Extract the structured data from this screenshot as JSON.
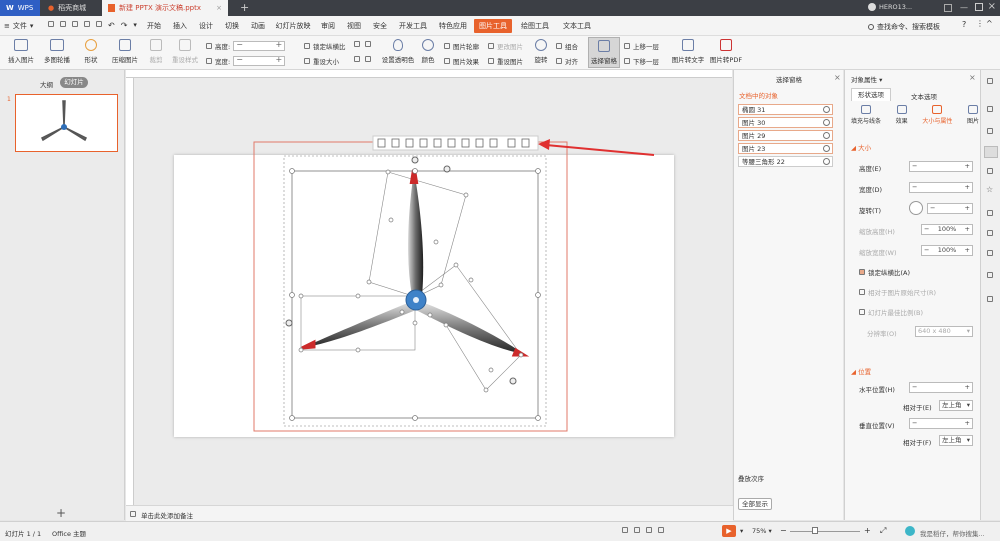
{
  "tabs": {
    "wps": "WPS",
    "store": "稻壳商城",
    "doc": "新建 PPTX 演示文稿.pptx",
    "add": "+"
  },
  "menu": {
    "file": "文件",
    "items": [
      "开始",
      "插入",
      "设计",
      "切换",
      "动画",
      "幻灯片放映",
      "审阅",
      "视图",
      "安全",
      "开发工具",
      "特色应用",
      "图片工具",
      "绘图工具",
      "文本工具"
    ],
    "search": "查找命令、搜索模板",
    "user": "HERO13..."
  },
  "ribbon": {
    "insert_picture": "插入图片",
    "multi_crop": "多图轮播",
    "shape": "形状",
    "compress": "压缩图片",
    "crop": "裁剪",
    "reset_size": "重设样式",
    "height_label": "高度:",
    "width_label": "宽度:",
    "lock_ratio": "锁定纵横比",
    "reset_size2": "重设大小",
    "transparent": "设置透明色",
    "color": "颜色",
    "pic_outline": "图片轮廓",
    "pic_effect": "图片效果",
    "change_pic": "更改图片",
    "reset_pic": "重设图片",
    "rotate": "旋转",
    "group": "组合",
    "align": "对齐",
    "select_pane": "选择窗格",
    "up_layer": "上移一层",
    "down_layer": "下移一层",
    "pic_to_text": "图片转文字",
    "pic_to_pdf": "图片转PDF"
  },
  "left": {
    "outline": "大纲",
    "slides": "幻灯片",
    "slide_num": "1"
  },
  "selection_pane": {
    "title": "选择窗格",
    "section": "文档中的对象",
    "objects": [
      "椭圆 31",
      "图片 30",
      "图片 29",
      "图片 23",
      "等腰三角形 22"
    ],
    "stack_order": "叠放次序",
    "show_all": "全部显示"
  },
  "props": {
    "title": "对象属性",
    "tab_shape": "形状选项",
    "tab_text": "文本选项",
    "sub_fill": "填充与线条",
    "sub_effect": "效果",
    "sub_size": "大小与属性",
    "sub_pic": "图片",
    "size_header": "大小",
    "height": "高度(E)",
    "width": "宽度(D)",
    "rotation": "旋转(T)",
    "scale_h": "缩放高度(H)",
    "scale_w": "缩放宽度(W)",
    "scale_h_val": "100%",
    "scale_w_val": "100%",
    "lock": "锁定纵横比(A)",
    "relative": "相对于图片原始尺寸(R)",
    "best_scale": "幻灯片最佳比例(B)",
    "resolution": "分辨率(O)",
    "resolution_val": "640 x 480",
    "pos_header": "位置",
    "h_pos": "水平位置(H)",
    "v_pos": "垂直位置(V)",
    "relative_to": "相对于(E)",
    "relative_to2": "相对于(F)",
    "top_left": "左上角",
    "top_left2": "左上角"
  },
  "notes": {
    "placeholder": "单击此处添加备注"
  },
  "status": {
    "slide": "幻灯片 1 / 1",
    "theme": "Office 主题",
    "zoom": "75%",
    "assistant": "我是稻仔，帮你搜集..."
  },
  "colors": {
    "accent": "#e8622c",
    "arrow": "#e03030",
    "tab_dark": "#3c3f45"
  }
}
